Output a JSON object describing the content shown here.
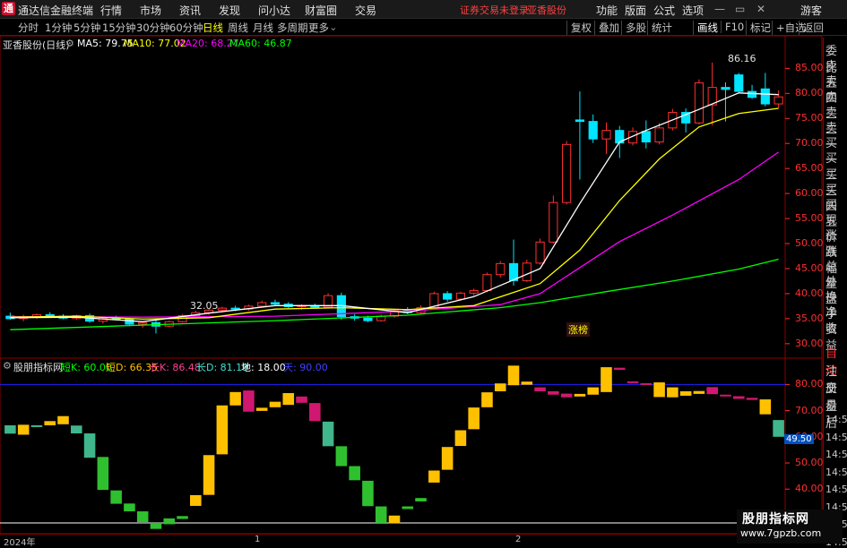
{
  "app": {
    "title": "通达信金融终端",
    "logo": "通"
  },
  "menu": [
    "行情",
    "市场",
    "资讯",
    "发现",
    "问小达",
    "财富圈",
    "交易"
  ],
  "warning": "证券交易未登录",
  "stock_name_top": "亚香股份",
  "right_menu": [
    "功能",
    "版面",
    "公式",
    "选项"
  ],
  "guest": "游客",
  "r_badge": "R",
  "periods": [
    "分时",
    "1分钟",
    "5分钟",
    "15分钟",
    "30分钟",
    "60分钟",
    "日线",
    "周线",
    "月线",
    "多周期",
    "更多"
  ],
  "active_period": "日线",
  "tools": [
    "复权",
    "叠加",
    "多股",
    "统计",
    "画线",
    "F10",
    "标记",
    "+自选",
    "返回"
  ],
  "price_legend": {
    "name": "亚香股份(日线)",
    "ma5": "MA5: 79.75",
    "ma10": "MA10: 77.02",
    "ma20": "MA20: 68.27",
    "ma60": "MA60: 46.87"
  },
  "indicator_legend": {
    "name": "股朋指标网",
    "k_short": "短K: 60.00",
    "d_short": "短D: 66.35",
    "k_long": "长K: 86.48",
    "d_long": "长D: 81.19",
    "ground": "地: 18.00",
    "sky": "天: 90.00"
  },
  "price_axis": [
    "85.00",
    "80.00",
    "75.00",
    "70.00",
    "65.00",
    "60.00",
    "55.00",
    "50.00",
    "45.00",
    "40.00",
    "35.00",
    "30.00"
  ],
  "ind_axis": [
    "80.00",
    "70.00",
    "60.00",
    "50.00",
    "40.00",
    "30.00"
  ],
  "ind_marker": "49.50",
  "high_label": "86.16",
  "low_label": "32.05",
  "zhangbang": "涨榜",
  "sidebar_top": [
    "委比",
    "卖五",
    "卖四",
    "卖三",
    "卖二",
    "卖一",
    "买一",
    "买二",
    "买三",
    "买四",
    "买五",
    "现价",
    "涨跌",
    "涨幅",
    "总量",
    "外盘",
    "换手",
    "净资",
    "收益"
  ],
  "sidebar_bottom": [
    "自动",
    "注册",
    "交易",
    "盘后",
    "14:56",
    "14:56",
    "14:56",
    "14:56",
    "14:56",
    "14:56",
    "14:56",
    "14:56"
  ],
  "dates": [
    "2024年",
    "1",
    "2"
  ],
  "watermark": {
    "line1": "股朋指标网",
    "line2": "www.7gpzb.com"
  },
  "colors": {
    "up": "#ff3030",
    "down": "#00e5ff",
    "ma5": "#ffffff",
    "ma10": "#ffff00",
    "ma20": "#ff00ff",
    "ma60": "#00ff00"
  },
  "chart_data": [
    {
      "type": "candlestick",
      "title": "亚香股份(日线)",
      "ylim": [
        28,
        89
      ],
      "candles": [
        [
          35.5,
          36.2,
          34.8,
          35.0
        ],
        [
          35.0,
          35.8,
          34.5,
          35.4
        ],
        [
          35.4,
          36.0,
          35.0,
          35.8
        ],
        [
          35.8,
          36.3,
          35.2,
          35.5
        ],
        [
          35.5,
          35.9,
          34.9,
          35.1
        ],
        [
          35.1,
          35.8,
          34.8,
          35.6
        ],
        [
          35.6,
          36.0,
          34.2,
          34.5
        ],
        [
          34.5,
          35.3,
          34.0,
          35.0
        ],
        [
          35.0,
          35.6,
          34.6,
          34.9
        ],
        [
          34.9,
          35.2,
          33.6,
          33.9
        ],
        [
          33.9,
          34.5,
          33.2,
          34.2
        ],
        [
          34.2,
          34.8,
          32.05,
          33.5
        ],
        [
          33.5,
          34.6,
          33.3,
          34.4
        ],
        [
          34.4,
          35.9,
          34.2,
          35.6
        ],
        [
          35.6,
          36.6,
          35.3,
          36.2
        ],
        [
          36.2,
          37.0,
          35.8,
          36.7
        ],
        [
          36.7,
          37.4,
          36.2,
          37.1
        ],
        [
          37.1,
          37.6,
          36.5,
          36.9
        ],
        [
          36.9,
          37.8,
          36.6,
          37.5
        ],
        [
          37.5,
          38.6,
          37.2,
          38.2
        ],
        [
          38.2,
          38.8,
          37.6,
          37.9
        ],
        [
          37.9,
          38.3,
          37.1,
          37.4
        ],
        [
          37.4,
          37.9,
          36.8,
          37.6
        ],
        [
          37.6,
          38.0,
          37.0,
          37.3
        ],
        [
          37.3,
          40.1,
          37.0,
          39.6
        ],
        [
          39.6,
          40.2,
          34.8,
          35.4
        ],
        [
          35.4,
          35.9,
          34.6,
          35.1
        ],
        [
          35.1,
          35.6,
          34.3,
          34.6
        ],
        [
          34.6,
          35.8,
          34.4,
          35.5
        ],
        [
          35.5,
          37.0,
          35.2,
          36.6
        ],
        [
          36.6,
          37.3,
          35.9,
          36.2
        ],
        [
          36.2,
          37.7,
          36.0,
          37.2
        ],
        [
          37.2,
          40.4,
          37.0,
          40.0
        ],
        [
          40.0,
          40.5,
          38.4,
          38.9
        ],
        [
          38.9,
          40.4,
          38.6,
          40.1
        ],
        [
          40.1,
          41.0,
          39.6,
          40.6
        ],
        [
          40.6,
          44.2,
          40.3,
          43.8
        ],
        [
          43.8,
          46.5,
          43.2,
          46.0
        ],
        [
          46.0,
          50.8,
          41.6,
          42.6
        ],
        [
          42.6,
          46.8,
          42.3,
          46.1
        ],
        [
          46.1,
          51.0,
          45.8,
          50.3
        ],
        [
          50.3,
          59.6,
          50.0,
          58.2
        ],
        [
          58.2,
          70.5,
          57.8,
          69.8
        ],
        [
          74.7,
          80.4,
          62.8,
          74.4
        ],
        [
          74.4,
          75.8,
          70.1,
          70.9
        ],
        [
          70.9,
          74.2,
          67.9,
          72.6
        ],
        [
          72.6,
          73.5,
          67.1,
          70.1
        ],
        [
          70.1,
          73.2,
          69.6,
          72.4
        ],
        [
          72.4,
          74.6,
          69.0,
          70.3
        ],
        [
          70.3,
          74.1,
          69.8,
          73.1
        ],
        [
          73.1,
          76.9,
          72.6,
          76.2
        ],
        [
          76.2,
          77.0,
          72.2,
          74.1
        ],
        [
          74.1,
          82.8,
          73.8,
          82.1
        ],
        [
          77.7,
          86.16,
          73.6,
          81.2
        ],
        [
          81.2,
          82.2,
          74.4,
          80.8
        ],
        [
          83.7,
          84.1,
          80.0,
          80.4
        ],
        [
          80.4,
          81.7,
          78.9,
          79.2
        ],
        [
          80.9,
          84.1,
          77.4,
          77.9
        ],
        [
          77.9,
          80.6,
          77.1,
          79.3
        ]
      ],
      "ma5": [
        [
          0,
          35.2
        ],
        [
          5,
          35.3
        ],
        [
          10,
          34.4
        ],
        [
          15,
          36.1
        ],
        [
          20,
          37.6
        ],
        [
          25,
          37.6
        ],
        [
          30,
          36.2
        ],
        [
          35,
          39.4
        ],
        [
          40,
          45.0
        ],
        [
          43,
          58.0
        ],
        [
          46,
          70.3
        ],
        [
          48,
          72.6
        ],
        [
          52,
          76.8
        ],
        [
          55,
          80.1
        ],
        [
          58,
          79.75
        ]
      ],
      "ma10": [
        [
          0,
          35.3
        ],
        [
          5,
          35.5
        ],
        [
          10,
          34.9
        ],
        [
          15,
          35.2
        ],
        [
          20,
          36.9
        ],
        [
          25,
          37.2
        ],
        [
          30,
          36.8
        ],
        [
          35,
          37.6
        ],
        [
          40,
          42.0
        ],
        [
          43,
          48.7
        ],
        [
          46,
          58.6
        ],
        [
          49,
          66.9
        ],
        [
          52,
          73.3
        ],
        [
          55,
          76.0
        ],
        [
          58,
          77.02
        ]
      ],
      "ma20": [
        [
          0,
          35.4
        ],
        [
          10,
          35.3
        ],
        [
          20,
          35.5
        ],
        [
          30,
          36.5
        ],
        [
          37,
          37.8
        ],
        [
          40,
          40.0
        ],
        [
          46,
          50.4
        ],
        [
          50,
          55.7
        ],
        [
          55,
          62.8
        ],
        [
          58,
          68.27
        ]
      ],
      "ma60": [
        [
          0,
          32.8
        ],
        [
          10,
          33.7
        ],
        [
          20,
          34.6
        ],
        [
          30,
          35.7
        ],
        [
          37,
          37.2
        ],
        [
          40,
          38.2
        ],
        [
          45,
          40.4
        ],
        [
          50,
          42.5
        ],
        [
          55,
          44.9
        ],
        [
          58,
          46.87
        ]
      ]
    },
    {
      "type": "bar",
      "title": "股朋指标网",
      "ylim": [
        24,
        88
      ],
      "sky_level": 80,
      "ground_level": 18,
      "short_bars": [
        [
          64.4,
          61.2
        ],
        [
          60.8,
          64.6
        ],
        [
          64.4,
          64.0
        ],
        [
          64.4,
          66.0
        ],
        [
          64.8,
          67.9
        ],
        [
          64.3,
          61.3
        ],
        [
          61.3,
          52.0
        ],
        [
          52.3,
          39.7
        ],
        [
          39.5,
          34.4
        ],
        [
          34.5,
          31.5
        ],
        [
          31.5,
          27.4
        ],
        [
          27.1,
          24.8
        ],
        [
          28.8,
          26.6
        ],
        [
          29.7,
          28.6
        ],
        [
          33.6,
          37.7
        ],
        [
          37.8,
          53.0
        ],
        [
          53.3,
          72.0
        ],
        [
          72.0,
          77.1
        ],
        [
          77.7,
          69.6
        ],
        [
          69.9,
          71.1
        ],
        [
          71.3,
          73.4
        ],
        [
          72.2,
          76.7
        ],
        [
          75.4,
          73.0
        ],
        [
          72.9,
          66.0
        ],
        [
          65.8,
          56.4
        ],
        [
          56.4,
          48.8
        ],
        [
          48.8,
          43.4
        ],
        [
          43.2,
          33.5
        ],
        [
          33.4,
          27.1
        ],
        [
          27.0,
          29.9
        ],
        [
          33.4,
          32.4
        ],
        [
          36.6,
          35.3
        ],
        [
          42.5,
          47.1
        ],
        [
          47.4,
          56.1
        ],
        [
          56.5,
          62.5
        ],
        [
          62.9,
          71.2
        ],
        [
          71.3,
          77.0
        ],
        [
          77.4,
          80.4
        ],
        [
          79.7,
          87.2
        ],
        [
          79.9,
          81.1
        ],
        [
          78.9,
          77.4
        ],
        [
          77.4,
          76.1
        ],
        [
          76.5,
          75.1
        ],
        [
          75.4,
          76.4
        ],
        [
          76.1,
          78.9
        ],
        [
          77.1,
          86.6
        ],
        [
          86.4,
          85.6
        ],
        [
          81.2,
          80.8
        ],
        [
          80.5,
          80.4
        ],
        [
          75.2,
          80.8
        ],
        [
          75.1,
          78.9
        ],
        [
          75.7,
          77.4
        ],
        [
          76.4,
          77.5
        ],
        [
          79.0,
          76.3
        ],
        [
          76.1,
          75.7
        ],
        [
          75.5,
          74.5
        ],
        [
          74.9,
          74.1
        ],
        [
          68.6,
          74.3
        ],
        [
          66.4,
          60.0
        ]
      ]
    }
  ]
}
